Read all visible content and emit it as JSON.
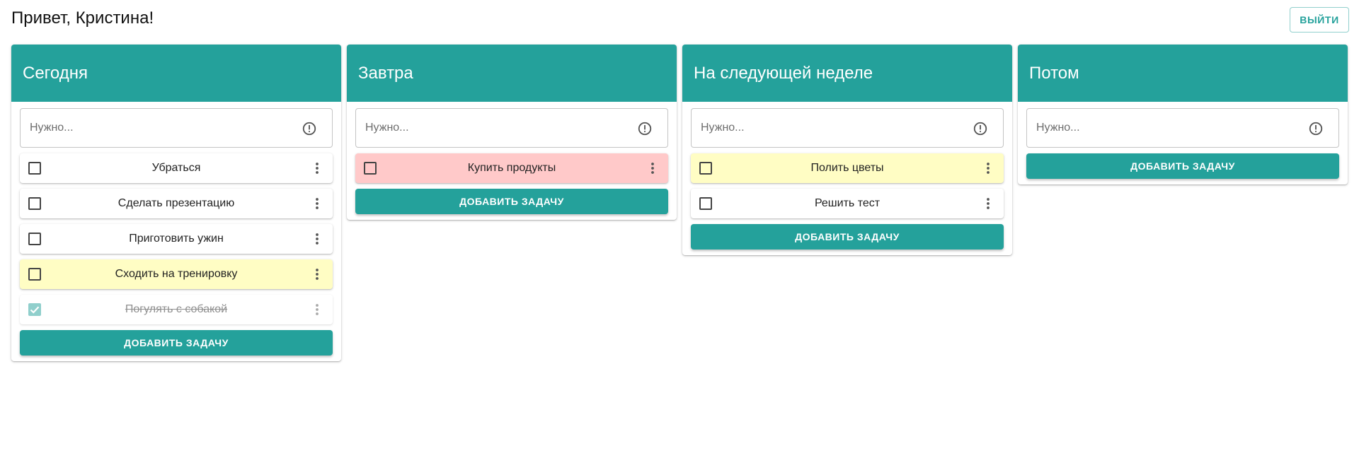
{
  "header": {
    "greeting": "Привет, Кристина!",
    "logout_label": "ВЫЙТИ"
  },
  "colors": {
    "accent": "#24a19b",
    "task_yellow": "#fffdc4",
    "task_red": "#ffc9c9"
  },
  "columns": [
    {
      "title": "Сегодня",
      "input_placeholder": "Нужно...",
      "add_label": "ДОБАВИТЬ ЗАДАЧУ",
      "tasks": [
        {
          "label": "Убраться",
          "color": "white",
          "done": false
        },
        {
          "label": "Сделать презентацию",
          "color": "white",
          "done": false
        },
        {
          "label": "Приготовить ужин",
          "color": "white",
          "done": false
        },
        {
          "label": "Сходить на тренировку",
          "color": "yellow",
          "done": false
        },
        {
          "label": "Погулять с собакой",
          "color": "white",
          "done": true
        }
      ]
    },
    {
      "title": "Завтра",
      "input_placeholder": "Нужно...",
      "add_label": "ДОБАВИТЬ ЗАДАЧУ",
      "tasks": [
        {
          "label": "Купить продукты",
          "color": "red",
          "done": false
        }
      ]
    },
    {
      "title": "На следующей неделе",
      "input_placeholder": "Нужно...",
      "add_label": "ДОБАВИТЬ ЗАДАЧУ",
      "tasks": [
        {
          "label": "Полить цветы",
          "color": "yellow",
          "done": false
        },
        {
          "label": "Решить тест",
          "color": "white",
          "done": false
        }
      ]
    },
    {
      "title": "Потом",
      "input_placeholder": "Нужно...",
      "add_label": "ДОБАВИТЬ ЗАДАЧУ",
      "tasks": []
    }
  ]
}
